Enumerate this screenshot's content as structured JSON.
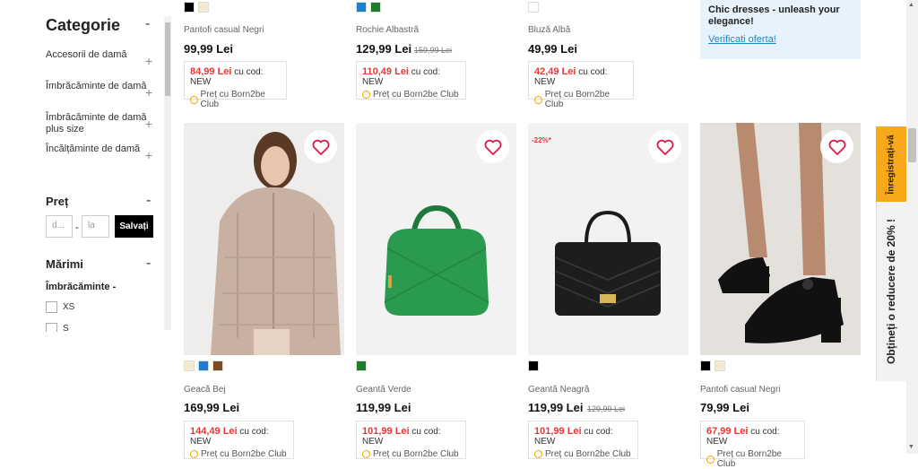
{
  "sidebar": {
    "title": "Categorie",
    "categories": [
      {
        "label": "Accesorii de damă"
      },
      {
        "label": "Îmbrăcăminte de damă"
      },
      {
        "label": "Îmbrăcăminte de damă plus size"
      },
      {
        "label": "Încălțăminte de damă"
      }
    ],
    "price": {
      "title": "Preț",
      "from_placeholder": "d...",
      "to_placeholder": "la",
      "separator": "-",
      "save_label": "Salvați"
    },
    "sizes": {
      "title": "Mărimi",
      "group_label": "Îmbrăcăminte -",
      "options": [
        "XS",
        "S"
      ]
    }
  },
  "top_row": [
    {
      "name": "Pantofi casual Negri",
      "price": "99,99 Lei",
      "old_price": "",
      "promo_price": "84,99 Lei",
      "swatches": [
        "#000000",
        "#f3e9cf"
      ]
    },
    {
      "name": "Rochie Albastră",
      "price": "129,99 Lei",
      "old_price": "159,99 Lei",
      "promo_price": "110,49 Lei",
      "swatches": [
        "#1e7fd0",
        "#1f7a2a"
      ]
    },
    {
      "name": "Bluză Albă",
      "price": "49,99 Lei",
      "old_price": "",
      "promo_price": "42,49 Lei",
      "swatches": [
        "#ffffff"
      ]
    }
  ],
  "banner": {
    "text": "Chic dresses - unleash your elegance!",
    "link": "Verificati oferta!"
  },
  "promo_common": {
    "code_text": "cu cod: NEW",
    "club_text": "Preț cu Born2be Club"
  },
  "products": [
    {
      "name": "Geacă Bej",
      "price": "169,99 Lei",
      "old_price": "",
      "promo_price": "144,49 Lei",
      "discount": "",
      "swatches": [
        "#f3e9cf",
        "#1e7fd0",
        "#7a4a22"
      ]
    },
    {
      "name": "Geantă Verde",
      "price": "119,99 Lei",
      "old_price": "",
      "promo_price": "101,99 Lei",
      "discount": "",
      "swatches": [
        "#1f7a2a"
      ]
    },
    {
      "name": "Geantă Neagră",
      "price": "119,99 Lei",
      "old_price": "129,99 Lei",
      "promo_price": "101,99 Lei",
      "discount": "-22%*",
      "swatches": [
        "#000000"
      ]
    },
    {
      "name": "Pantofi casual Negri",
      "price": "79,99 Lei",
      "old_price": "",
      "promo_price": "67,99 Lei",
      "discount": "",
      "swatches": [
        "#000000",
        "#f3e9cf"
      ]
    }
  ],
  "side_tab": {
    "register": "Înregistrați-vă",
    "discount": "Obțineți o reducere de 20% !"
  }
}
